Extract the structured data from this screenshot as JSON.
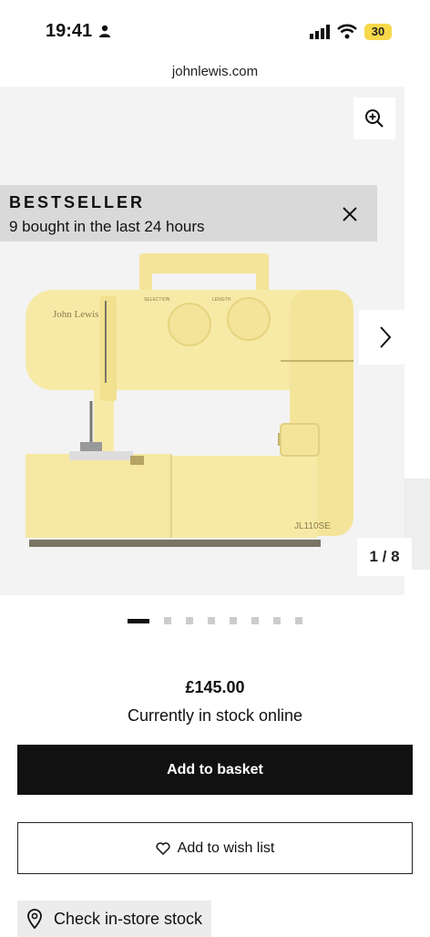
{
  "status_bar": {
    "time": "19:41",
    "battery": "30"
  },
  "browser": {
    "url": "johnlewis.com"
  },
  "gallery": {
    "badge_title": "BESTSELLER",
    "badge_subtitle": "9 bought in the last 24 hours",
    "counter": "1 / 8",
    "slide_count": 8,
    "active_slide": 1,
    "product_brand": "John Lewis",
    "product_model": "JL110SE",
    "dial_left_label": "SELECTION",
    "dial_right_label": "LENGTH"
  },
  "product": {
    "price": "£145.00",
    "stock_status": "Currently in stock online"
  },
  "actions": {
    "add_to_basket": "Add to basket",
    "add_to_wishlist": "Add to wish list",
    "check_store": "Check in-store stock"
  },
  "colors": {
    "machine": "#f7eaa6",
    "primary_button": "#111111",
    "battery": "#f8d84a"
  }
}
